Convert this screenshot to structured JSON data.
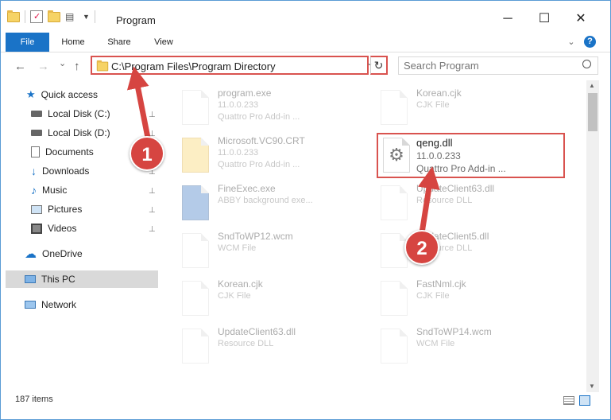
{
  "window": {
    "title": "Program",
    "min": "─",
    "max": "☐",
    "close": "✕"
  },
  "ribbon": {
    "tabs": [
      "File",
      "Home",
      "Share",
      "View"
    ],
    "help": "?",
    "collapse": "⌄"
  },
  "nav": {
    "back": "←",
    "forward": "→",
    "dropdown": "⌄",
    "up": "↑",
    "address": "C:\\Program Files\\Program Directory",
    "addr_dropdown": "⌄",
    "refresh": "↻",
    "search_placeholder": "Search Program"
  },
  "sidebar": {
    "quick_access": "Quick access",
    "items": [
      {
        "label": "Local Disk (C:)",
        "pinned": true
      },
      {
        "label": "Local Disk (D:)",
        "pinned": true
      },
      {
        "label": "Documents",
        "pinned": true
      },
      {
        "label": "Downloads",
        "pinned": true
      },
      {
        "label": "Music",
        "pinned": true
      },
      {
        "label": "Pictures",
        "pinned": true
      },
      {
        "label": "Videos",
        "pinned": true
      }
    ],
    "onedrive": "OneDrive",
    "thispc": "This PC",
    "network": "Network",
    "pin": "📌"
  },
  "files": [
    {
      "name": "program.exe",
      "l2": "11.0.0.233",
      "l3": "Quattro Pro Add-in ..."
    },
    {
      "name": "Korean.cjk",
      "l2": "CJK File",
      "l3": ""
    },
    {
      "name": "Microsoft.VC90.CRT",
      "l2": "11.0.0.233",
      "l3": "Quattro Pro Add-in ..."
    },
    {
      "name": "qeng.dll",
      "l2": "11.0.0.233",
      "l3": "Quattro Pro Add-in ..."
    },
    {
      "name": "FineExec.exe",
      "l2": "ABBY background exe...",
      "l3": ""
    },
    {
      "name": "UpdateClient63.dll",
      "l2": "Resource DLL",
      "l3": ""
    },
    {
      "name": "SndToWP12.wcm",
      "l2": "WCM File",
      "l3": ""
    },
    {
      "name": "UpdateClient5.dll",
      "l2": "Resource DLL",
      "l3": ""
    },
    {
      "name": "Korean.cjk",
      "l2": "CJK File",
      "l3": ""
    },
    {
      "name": "FastNml.cjk",
      "l2": "CJK File",
      "l3": ""
    },
    {
      "name": "UpdateClient63.dll",
      "l2": "Resource DLL",
      "l3": ""
    },
    {
      "name": "SndToWP14.wcm",
      "l2": "WCM File",
      "l3": ""
    }
  ],
  "status": {
    "count": "187 items"
  },
  "annotations": {
    "step1": "1",
    "step2": "2",
    "color": "#d64541"
  },
  "colors": {
    "accent": "#1a73c7",
    "highlight": "#d9534f"
  }
}
